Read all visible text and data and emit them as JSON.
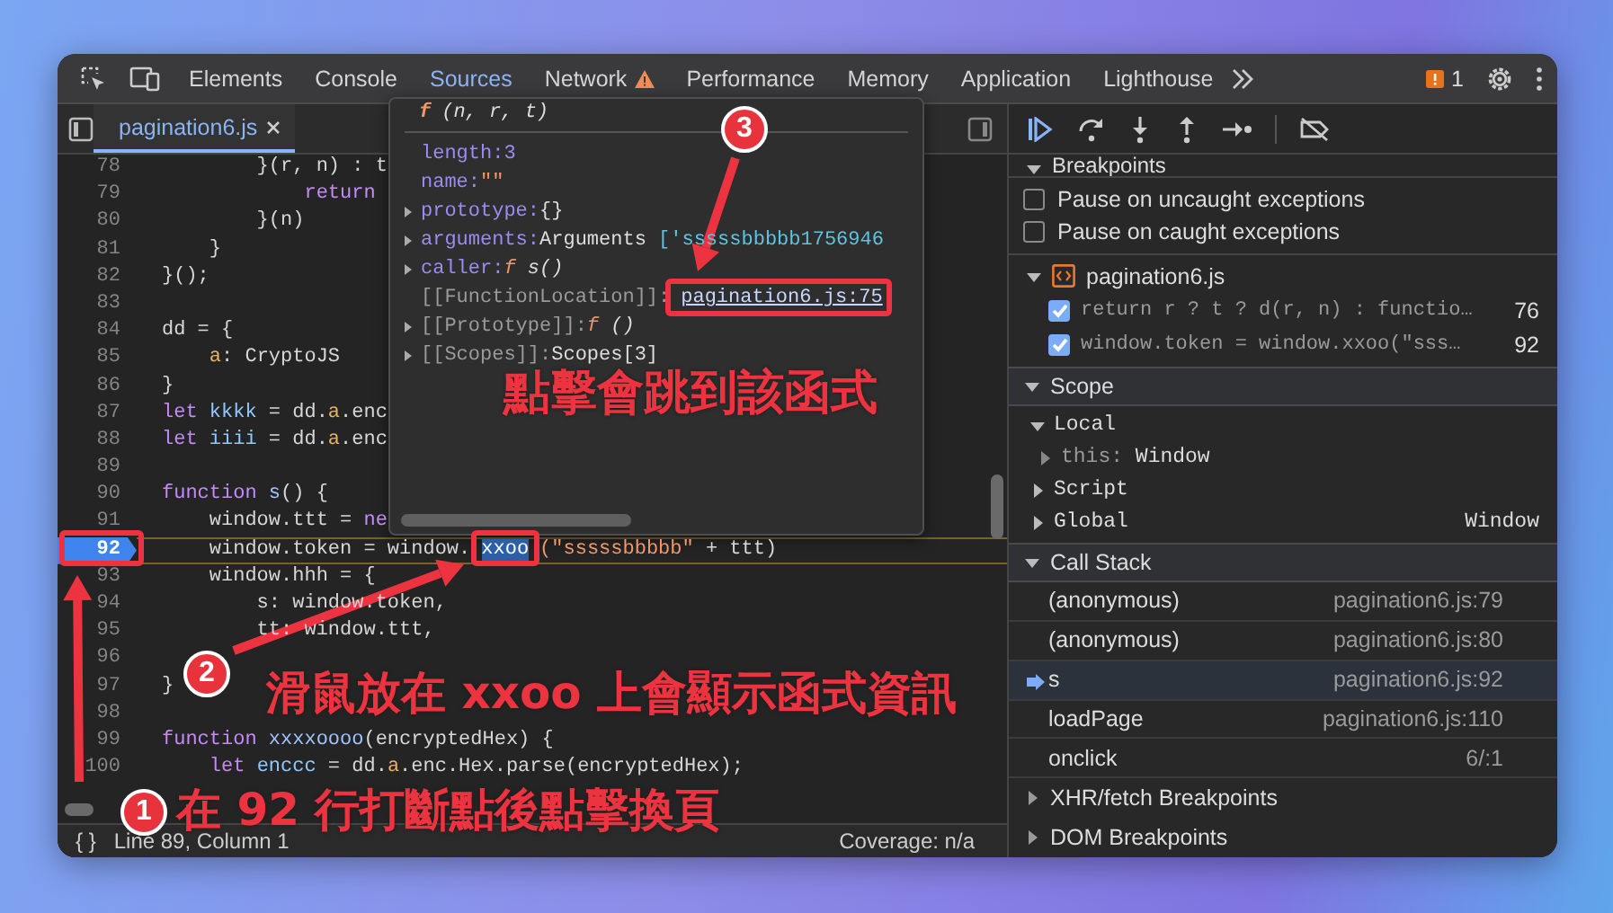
{
  "toolbar": {
    "tabs": [
      {
        "label": "Elements",
        "selected": false,
        "warning": false
      },
      {
        "label": "Console",
        "selected": false,
        "warning": false
      },
      {
        "label": "Sources",
        "selected": true,
        "warning": false
      },
      {
        "label": "Network",
        "selected": false,
        "warning": true
      },
      {
        "label": "Performance",
        "selected": false,
        "warning": false
      },
      {
        "label": "Memory",
        "selected": false,
        "warning": false
      },
      {
        "label": "Application",
        "selected": false,
        "warning": false
      },
      {
        "label": "Lighthouse",
        "selected": false,
        "warning": false
      }
    ],
    "issues_count": "1"
  },
  "editor": {
    "file_tabs": [
      {
        "label": "pagination6.js",
        "selected": true
      }
    ],
    "lines": [
      {
        "number": "78",
        "breakpoint": false,
        "paused": false,
        "parts": [
          {
            "kind": "plain",
            "text": "        }(r, n) : t"
          }
        ]
      },
      {
        "number": "79",
        "breakpoint": false,
        "paused": false,
        "parts": [
          {
            "kind": "keyword",
            "text": "            return"
          }
        ]
      },
      {
        "number": "80",
        "breakpoint": false,
        "paused": false,
        "parts": [
          {
            "kind": "plain",
            "text": "        }(n)"
          }
        ]
      },
      {
        "number": "81",
        "breakpoint": false,
        "paused": false,
        "parts": [
          {
            "kind": "plain",
            "text": "    }"
          }
        ]
      },
      {
        "number": "82",
        "breakpoint": false,
        "paused": false,
        "parts": [
          {
            "kind": "plain",
            "text": "}();"
          }
        ]
      },
      {
        "number": "83",
        "breakpoint": false,
        "paused": false
      },
      {
        "number": "84",
        "breakpoint": false,
        "paused": false,
        "parts": [
          {
            "kind": "plain",
            "text": "dd = {"
          }
        ]
      },
      {
        "number": "85",
        "breakpoint": false,
        "paused": false,
        "parts": [
          {
            "kind": "property",
            "text": "    a"
          },
          {
            "kind": "plain",
            "text": ": CryptoJS"
          }
        ]
      },
      {
        "number": "86",
        "breakpoint": false,
        "paused": false,
        "parts": [
          {
            "kind": "plain",
            "text": "}"
          }
        ]
      },
      {
        "number": "87",
        "breakpoint": false,
        "paused": false,
        "parts": [
          {
            "kind": "keyword",
            "text": "let "
          },
          {
            "kind": "variable",
            "text": "kkkk"
          },
          {
            "kind": "plain",
            "text": " = dd."
          },
          {
            "kind": "property",
            "text": "a"
          },
          {
            "kind": "plain",
            "text": ".enc"
          }
        ]
      },
      {
        "number": "88",
        "breakpoint": false,
        "paused": false,
        "parts": [
          {
            "kind": "keyword",
            "text": "let "
          },
          {
            "kind": "variable",
            "text": "iiii"
          },
          {
            "kind": "plain",
            "text": " = dd."
          },
          {
            "kind": "property",
            "text": "a"
          },
          {
            "kind": "plain",
            "text": ".enc"
          }
        ]
      },
      {
        "number": "89",
        "breakpoint": false,
        "paused": false
      },
      {
        "number": "90",
        "breakpoint": false,
        "paused": false,
        "parts": [
          {
            "kind": "keyword",
            "text": "function "
          },
          {
            "kind": "function",
            "text": "s"
          },
          {
            "kind": "plain",
            "text": "() {"
          }
        ]
      },
      {
        "number": "91",
        "breakpoint": false,
        "paused": false,
        "parts": [
          {
            "kind": "plain",
            "text": "    window.ttt = "
          },
          {
            "kind": "keyword",
            "text": "ne"
          }
        ]
      },
      {
        "number": "92",
        "breakpoint": true,
        "paused": true,
        "parts": [
          {
            "kind": "plain",
            "text": "    window.token = window."
          },
          {
            "kind": "hover",
            "text": "xxoo"
          },
          {
            "kind": "string",
            "text": "(\"sssssbbbbb\""
          },
          {
            "kind": "plain",
            "text": " + ttt)"
          }
        ]
      },
      {
        "number": "93",
        "breakpoint": false,
        "paused": false,
        "parts": [
          {
            "kind": "plain",
            "text": "    window.hhh = {"
          }
        ]
      },
      {
        "number": "94",
        "breakpoint": false,
        "paused": false,
        "parts": [
          {
            "kind": "plain",
            "text": "        s: window.token,"
          }
        ]
      },
      {
        "number": "95",
        "breakpoint": false,
        "paused": false,
        "parts": [
          {
            "kind": "plain",
            "text": "        tt: window.ttt,"
          }
        ]
      },
      {
        "number": "96",
        "breakpoint": false,
        "paused": false
      },
      {
        "number": "97",
        "breakpoint": false,
        "paused": false,
        "parts": [
          {
            "kind": "plain",
            "text": "}"
          }
        ]
      },
      {
        "number": "98",
        "breakpoint": false,
        "paused": false
      },
      {
        "number": "99",
        "breakpoint": false,
        "paused": false,
        "parts": [
          {
            "kind": "keyword",
            "text": "function "
          },
          {
            "kind": "function",
            "text": "xxxxoooo"
          },
          {
            "kind": "plain",
            "text": "(encryptedHex) {"
          }
        ]
      },
      {
        "number": "100",
        "breakpoint": false,
        "paused": false,
        "parts": [
          {
            "kind": "keyword",
            "text": "    let "
          },
          {
            "kind": "variable",
            "text": "enccc"
          },
          {
            "kind": "plain",
            "text": " = dd."
          },
          {
            "kind": "property",
            "text": "a"
          },
          {
            "kind": "plain",
            "text": ".enc.Hex.parse(encryptedHex);"
          }
        ]
      }
    ],
    "pretty_print": "{ }",
    "cursor_position": "Line 89, Column 1",
    "coverage": "Coverage: n/a"
  },
  "hover_popup": {
    "keyword": "f",
    "signature": "(n, r, t)",
    "properties": [
      {
        "key": "length:",
        "kind": "number",
        "value": "3",
        "expandable": false
      },
      {
        "key": "name:",
        "kind": "string",
        "value": "\"\"",
        "expandable": false
      },
      {
        "key": "prototype:",
        "kind": "plain",
        "value": "{}",
        "expandable": true
      },
      {
        "key": "arguments:",
        "kind": "arguments",
        "value": "Arguments",
        "detail": "['sssssbbbbb1756946",
        "expandable": true
      },
      {
        "key": "caller:",
        "kind": "function",
        "keyword": "f",
        "value": "s()",
        "expandable": true
      },
      {
        "key": "[[FunctionLocation]]:",
        "kind": "link",
        "value": "pagination6.js:75",
        "expandable": false
      },
      {
        "key": "[[Prototype]]:",
        "kind": "function",
        "keyword": "f",
        "value": "()",
        "expandable": true
      },
      {
        "key": "[[Scopes]]:",
        "kind": "plain",
        "value": "Scopes[3]",
        "expandable": true
      }
    ]
  },
  "debugger": {
    "breakpoints": {
      "title": "Breakpoints",
      "expanded": true,
      "pause_options": [
        {
          "label": "Pause on uncaught exceptions",
          "checked": false
        },
        {
          "label": "Pause on caught exceptions",
          "checked": false
        }
      ],
      "files": [
        {
          "name": "pagination6.js",
          "expanded": true,
          "items": [
            {
              "code": "return r ? t ? d(r, n) : functio…",
              "line": "76",
              "checked": true
            },
            {
              "code": "window.token = window.xxoo(\"sss…",
              "line": "92",
              "checked": true
            }
          ]
        }
      ]
    },
    "scope": {
      "title": "Scope",
      "expanded": true,
      "groups": [
        {
          "name": "Local",
          "expanded": true,
          "children": [
            {
              "name": "this:",
              "value": "Window",
              "expanded": false
            }
          ]
        },
        {
          "name": "Script",
          "expanded": false
        },
        {
          "name": "Global",
          "expanded": false,
          "value": "Window"
        }
      ]
    },
    "call_stack": {
      "title": "Call Stack",
      "expanded": true,
      "frames": [
        {
          "name": "(anonymous)",
          "location": "pagination6.js:79",
          "selected": false
        },
        {
          "name": "(anonymous)",
          "location": "pagination6.js:80",
          "selected": false
        },
        {
          "name": "s",
          "location": "pagination6.js:92",
          "selected": true
        },
        {
          "name": "loadPage",
          "location": "pagination6.js:110",
          "selected": false
        },
        {
          "name": "onclick",
          "location": "6/:1",
          "selected": false
        }
      ]
    },
    "more_sections": [
      {
        "title": "XHR/fetch Breakpoints",
        "expanded": false
      },
      {
        "title": "DOM Breakpoints",
        "expanded": false
      }
    ]
  },
  "annotations": [
    {
      "number": "3",
      "caption": "點擊會跳到該函式"
    },
    {
      "number": "2",
      "caption": "滑鼠放在 xxoo 上會顯示函式資訊"
    },
    {
      "number": "1",
      "caption": "在 92 行打斷點後點擊換頁"
    }
  ]
}
